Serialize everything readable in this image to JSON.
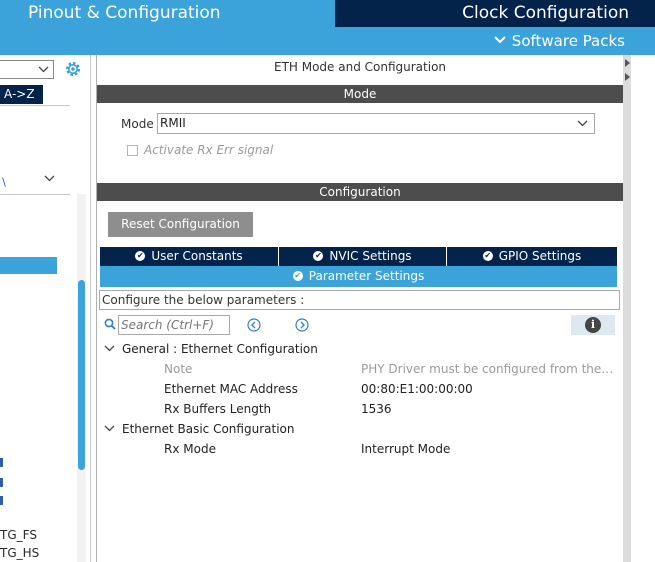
{
  "header": {
    "pinout_tab": "Pinout & Configuration",
    "clock_tab": "Clock Configuration",
    "software_packs": "Software Packs"
  },
  "sidebar": {
    "sort_button": "A->Z",
    "items": [
      "TG_FS",
      "TG_HS"
    ]
  },
  "main": {
    "title": "ETH Mode and Configuration",
    "mode_section": "Mode",
    "mode_label": "Mode",
    "mode_value": "RMII",
    "activate_rx_err": "Activate Rx Err signal",
    "configuration_section": "Configuration",
    "reset_button": "Reset Configuration",
    "tabs": [
      {
        "label": "User Constants"
      },
      {
        "label": "NVIC Settings"
      },
      {
        "label": "GPIO Settings"
      }
    ],
    "active_tab": "Parameter Settings",
    "configure_text": "Configure the below parameters :",
    "search_placeholder": "Search (Ctrl+F)",
    "groups": [
      {
        "title": "General : Ethernet Configuration",
        "params": [
          {
            "name": "Note",
            "value": "PHY Driver must be configured from the L..."
          },
          {
            "name": "Ethernet MAC Address",
            "value": "00:80:E1:00:00:00"
          },
          {
            "name": "Rx Buffers Length",
            "value": "1536"
          }
        ]
      },
      {
        "title": "Ethernet Basic Configuration",
        "params": [
          {
            "name": "Rx Mode",
            "value": "Interrupt Mode"
          }
        ]
      }
    ]
  },
  "colors": {
    "accent_blue": "#3ba3d9",
    "navy": "#03234b",
    "section_header": "#4d4d4d",
    "reset_button": "#8e8e8e"
  },
  "icons": [
    "chevron-down-icon",
    "gear-icon",
    "search-icon",
    "prev-arrow-icon",
    "next-arrow-icon",
    "info-icon",
    "check-circle-icon",
    "collapse-arrow-icon"
  ]
}
